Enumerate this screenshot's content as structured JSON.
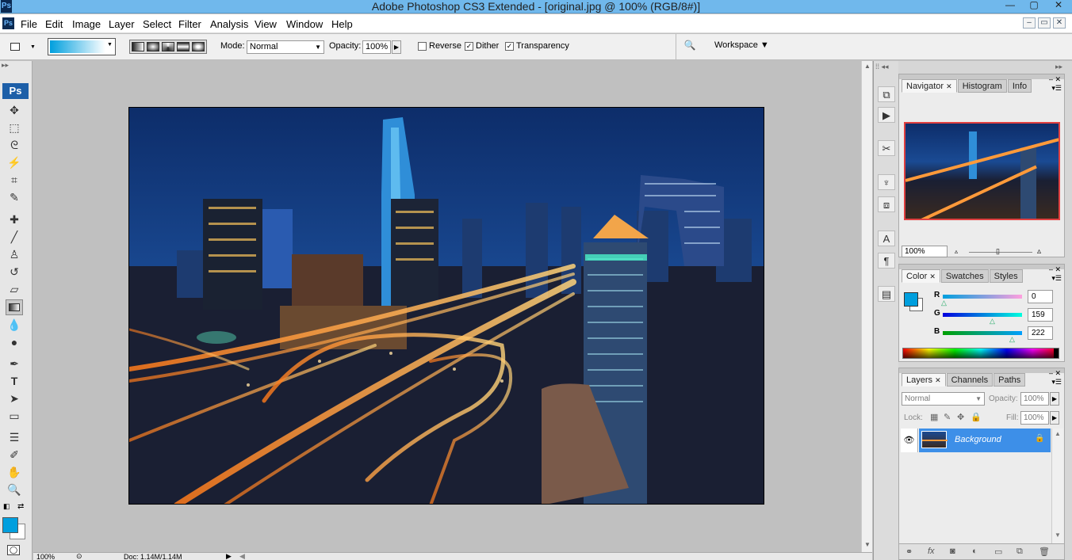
{
  "window": {
    "title": "Adobe Photoshop CS3 Extended - [original.jpg @ 100% (RGB/8#)]",
    "app_badge": "Ps",
    "min": "—",
    "max": "▢",
    "close": "✕"
  },
  "menu": [
    "File",
    "Edit",
    "Image",
    "Layer",
    "Select",
    "Filter",
    "Analysis",
    "View",
    "Window",
    "Help"
  ],
  "options": {
    "mode_label": "Mode:",
    "mode_value": "Normal",
    "opacity_label": "Opacity:",
    "opacity_value": "100%",
    "reverse_label": "Reverse",
    "dither_label": "Dither",
    "transparency_label": "Transparency",
    "workspace_label": "Workspace ▼"
  },
  "toolbox": {
    "logo": "Ps"
  },
  "status": {
    "zoom": "100%",
    "doc": "Doc: 1.14M/1.14M"
  },
  "navigator": {
    "tabs": [
      "Navigator",
      "Histogram",
      "Info"
    ],
    "zoom": "100%"
  },
  "color_panel": {
    "tabs": [
      "Color",
      "Swatches",
      "Styles"
    ],
    "r_label": "R",
    "r_value": "0",
    "g_label": "G",
    "g_value": "159",
    "b_label": "B",
    "b_value": "222",
    "foreground": "#009fde"
  },
  "layers_panel": {
    "tabs": [
      "Layers",
      "Channels",
      "Paths"
    ],
    "blend_mode": "Normal",
    "opacity_label": "Opacity:",
    "opacity_value": "100%",
    "lock_label": "Lock:",
    "fill_label": "Fill:",
    "fill_value": "100%",
    "layer_name": "Background"
  }
}
